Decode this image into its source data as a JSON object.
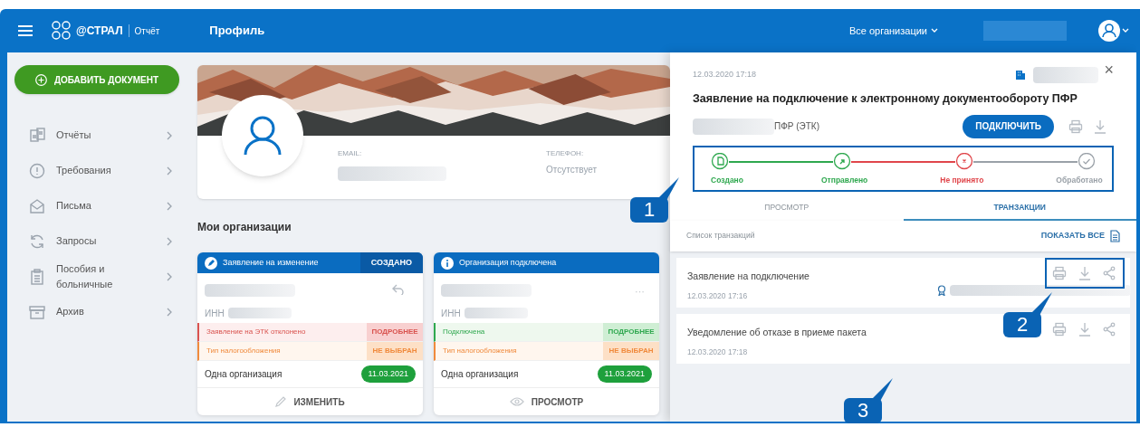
{
  "header": {
    "brand": "@СТРАЛ",
    "product": "Отчёт",
    "page_title": "Профиль",
    "org_selector": "Все организации"
  },
  "sidebar": {
    "add_button": "ДОБАВИТЬ ДОКУМЕНТ",
    "items": [
      {
        "kind": "reports",
        "label": "Отчёты"
      },
      {
        "kind": "requirements",
        "label": "Требования"
      },
      {
        "kind": "letters",
        "label": "Письма"
      },
      {
        "kind": "requests",
        "label": "Запросы"
      },
      {
        "kind": "benefits",
        "label": "Пособия и больничные"
      },
      {
        "kind": "archive",
        "label": "Архив"
      }
    ]
  },
  "profile": {
    "email_label": "EMAIL:",
    "phone_label": "ТЕЛЕФОН:",
    "phone_value": "Отсутствует"
  },
  "organizations": {
    "title": "Мои организации",
    "cards": [
      {
        "kind": "edit",
        "header": "Заявление на изменение",
        "badge": "СОЗДАНО",
        "inn_label": "ИНН",
        "rows": [
          {
            "kind": "error",
            "text": "Заявление на ЭТК отклонено",
            "action": "ПОДРОБНЕЕ"
          },
          {
            "kind": "warning",
            "text": "Тип налогообложения",
            "action": "НЕ ВЫБРАН"
          }
        ],
        "plan": "Одна организация",
        "date": "11.03.2021",
        "footer": "ИЗМЕНИТЬ"
      },
      {
        "kind": "info",
        "header": "Организация подключена",
        "inn_label": "ИНН",
        "menu": "···",
        "rows": [
          {
            "kind": "success",
            "text": "Подключена",
            "action": "ПОДРОБНЕЕ"
          },
          {
            "kind": "warning",
            "text": "Тип налогообложения",
            "action": "НЕ ВЫБРАН"
          }
        ],
        "plan": "Одна организация",
        "date": "11.03.2021",
        "footer": "ПРОСМОТР"
      }
    ]
  },
  "panel": {
    "date": "12.03.2020 17:18",
    "close": "×",
    "title": "Заявление на подключение к электронному документообороту ПФР",
    "recipient": "ПФР (ЭТК)",
    "connect_button": "ПОДКЛЮЧИТЬ",
    "steps": [
      {
        "kind": "created",
        "color": "#2fa84f",
        "label": "Создано"
      },
      {
        "kind": "sent",
        "color": "#2fa84f",
        "label": "Отправлено"
      },
      {
        "kind": "rejected",
        "color": "#e0464b",
        "label": "Не принято"
      },
      {
        "kind": "processed",
        "color": "#9aa1a8",
        "label": "Обработано"
      }
    ],
    "tabs": [
      {
        "label": "ПРОСМОТР",
        "selected": false
      },
      {
        "label": "ТРАНЗАКЦИИ",
        "selected": true
      }
    ],
    "list_title": "Список транзакций",
    "show_all": "ПОКАЗАТЬ ВСЕ",
    "transactions": [
      {
        "title": "Заявление на подключение",
        "date": "12.03.2020 17:16",
        "signed": true,
        "highlighted": true
      },
      {
        "title": "Уведомление об отказе в приеме пакета",
        "date": "12.03.2020 17:18",
        "signed": false,
        "highlighted": false
      }
    ]
  },
  "callouts": [
    {
      "label": "1"
    },
    {
      "label": "2"
    },
    {
      "label": "3"
    }
  ]
}
